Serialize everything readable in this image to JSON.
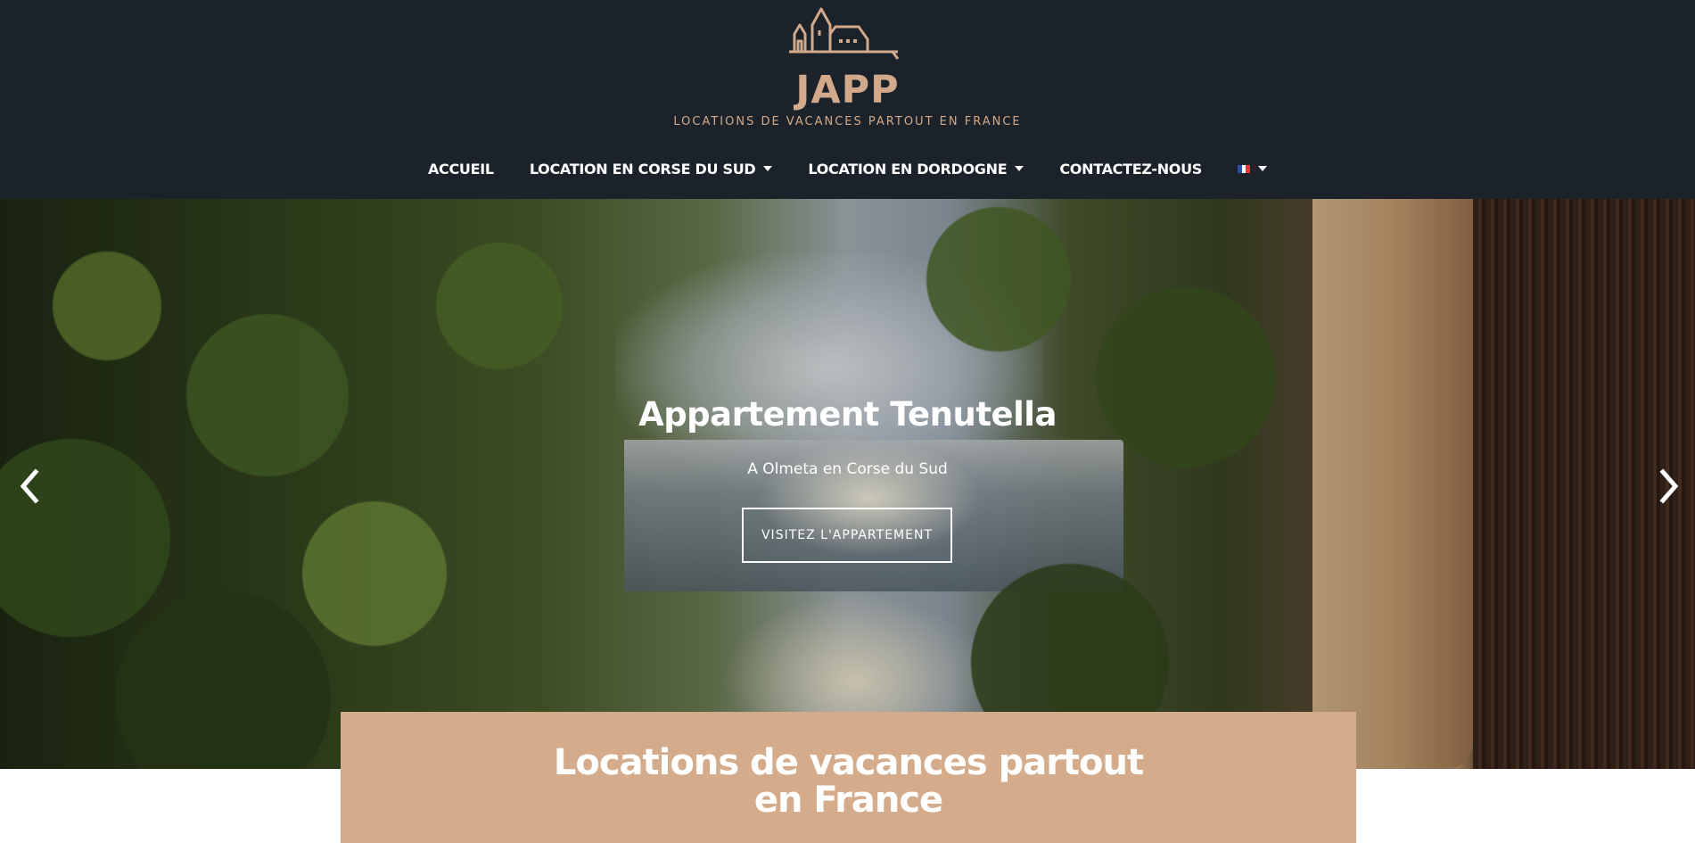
{
  "brand": {
    "name": "JAPP",
    "tagline": "LOCATIONS DE VACANCES PARTOUT EN FRANCE",
    "logo_icon": "house-village-icon",
    "color": "#d2a98a"
  },
  "nav": {
    "items": [
      {
        "label": "ACCUEIL",
        "has_dropdown": false
      },
      {
        "label": "LOCATION EN CORSE DU SUD",
        "has_dropdown": true
      },
      {
        "label": "LOCATION EN DORDOGNE",
        "has_dropdown": true
      },
      {
        "label": "CONTACTEZ-NOUS",
        "has_dropdown": false
      }
    ],
    "language": {
      "icon": "french-flag-icon",
      "has_dropdown": true
    }
  },
  "hero": {
    "title": "Appartement Tenutella",
    "subtitle": "A Olmeta en Corse du Sud",
    "button_label": "VISITEZ L'APPARTEMENT",
    "prev_icon": "chevron-left-icon",
    "next_icon": "chevron-right-icon"
  },
  "intro": {
    "title": "Locations de vacances partout en France",
    "background": "#d4ab8b"
  },
  "colors": {
    "header_bg": "#1c2229",
    "accent": "#d2a98a"
  }
}
